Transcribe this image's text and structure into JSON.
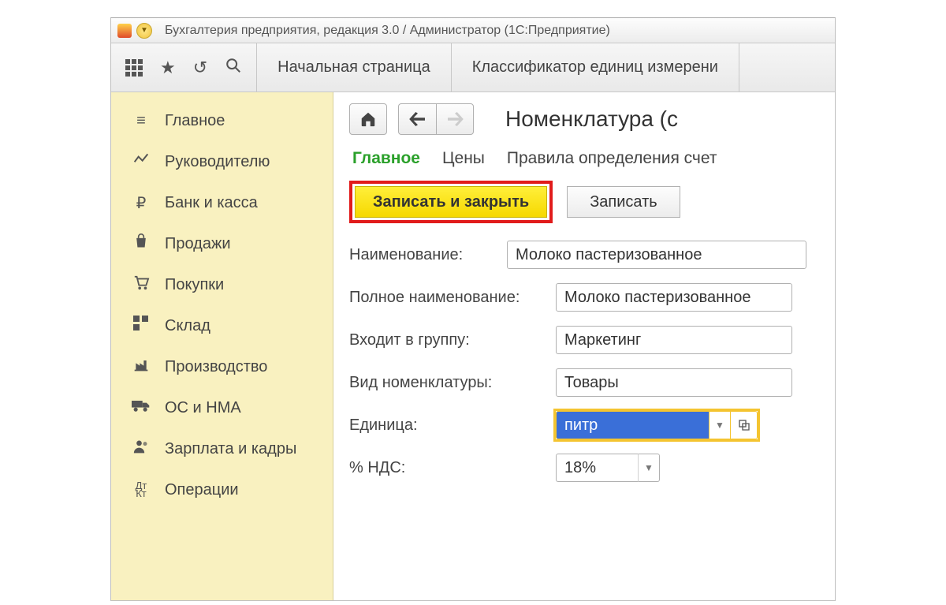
{
  "titlebar": {
    "app_title": "Бухгалтерия предприятия, редакция 3.0 / Администратор  (1С:Предприятие)"
  },
  "toolbar": {
    "tabs": {
      "home": "Начальная страница",
      "classifier": "Классификатор единиц измерени"
    }
  },
  "sidebar": {
    "items": [
      {
        "icon": "menu-icon",
        "label": "Главное"
      },
      {
        "icon": "chart-icon",
        "label": "Руководителю"
      },
      {
        "icon": "ruble-icon",
        "label": "Банк и касса"
      },
      {
        "icon": "bag-icon",
        "label": "Продажи"
      },
      {
        "icon": "cart-icon",
        "label": "Покупки"
      },
      {
        "icon": "boxes-icon",
        "label": "Склад"
      },
      {
        "icon": "factory-icon",
        "label": "Производство"
      },
      {
        "icon": "truck-icon",
        "label": "ОС и НМА"
      },
      {
        "icon": "person-icon",
        "label": "Зарплата и кадры"
      },
      {
        "icon": "ops-icon",
        "label": "Операции"
      }
    ]
  },
  "main": {
    "page_title": "Номенклатура (с",
    "subnav": {
      "main": "Главное",
      "prices": "Цены",
      "rules": "Правила определения счет"
    },
    "actions": {
      "save_close": "Записать и закрыть",
      "save": "Записать"
    },
    "form": {
      "name_label": "Наименование:",
      "name_value": "Молоко пастеризованное",
      "fullname_label": "Полное наименование:",
      "fullname_value": "Молоко пастеризованное",
      "group_label": "Входит в группу:",
      "group_value": "Маркетинг",
      "kind_label": "Вид номенклатуры:",
      "kind_value": "Товары",
      "unit_label": "Единица:",
      "unit_value": "питр",
      "vat_label": "% НДС:",
      "vat_value": "18%"
    }
  }
}
